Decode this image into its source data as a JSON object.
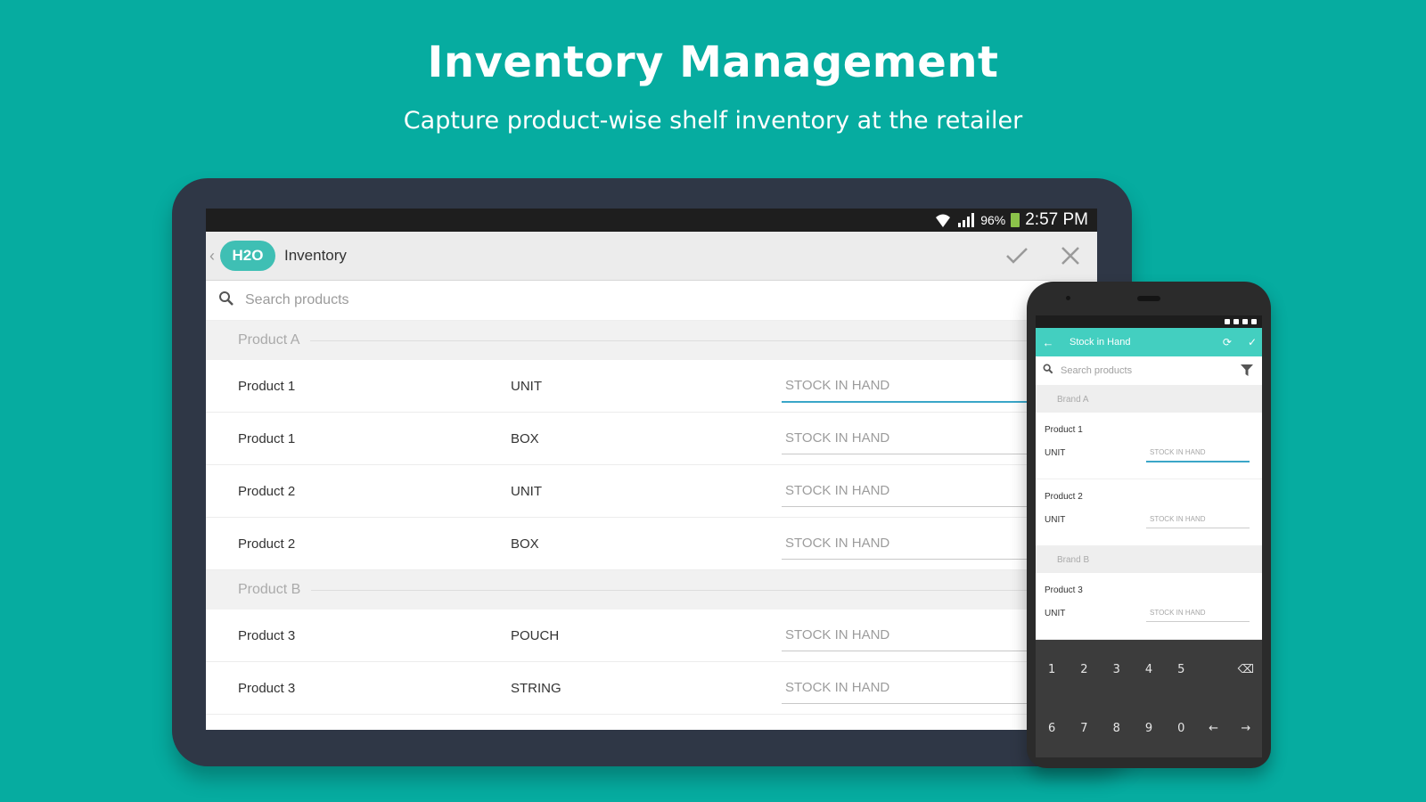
{
  "hero": {
    "title": "Inventory Management",
    "subtitle": "Capture product-wise shelf inventory at the retailer"
  },
  "tablet": {
    "status": {
      "battery": "96%",
      "time": "2:57 PM"
    },
    "appbar": {
      "logo_text": "H2O",
      "title": "Inventory",
      "confirm_icon": "check-icon",
      "close_icon": "close-icon"
    },
    "search": {
      "placeholder": "Search products"
    },
    "field_placeholder": "STOCK IN HAND",
    "groups": [
      {
        "name": "Product A",
        "rows": [
          {
            "product": "Product 1",
            "unit": "UNIT"
          },
          {
            "product": "Product 1",
            "unit": "BOX"
          },
          {
            "product": "Product 2",
            "unit": "UNIT"
          },
          {
            "product": "Product 2",
            "unit": "BOX"
          }
        ]
      },
      {
        "name": "Product B",
        "rows": [
          {
            "product": "Product 3",
            "unit": "POUCH"
          },
          {
            "product": "Product 3",
            "unit": "STRING"
          }
        ]
      }
    ]
  },
  "phone": {
    "appbar": {
      "title": "Stock in Hand"
    },
    "search": {
      "placeholder": "Search products"
    },
    "field_placeholder": "STOCK IN HAND",
    "groups": [
      {
        "name": "Brand A",
        "items": [
          {
            "product": "Product 1",
            "unit": "UNIT"
          },
          {
            "product": "Product 2",
            "unit": "UNIT"
          }
        ]
      },
      {
        "name": "Brand B",
        "items": [
          {
            "product": "Product 3",
            "unit": "UNIT"
          }
        ]
      }
    ],
    "keypad": [
      "1",
      "2",
      "3",
      "4",
      "5",
      "",
      "⌫",
      "6",
      "7",
      "8",
      "9",
      "0",
      "←",
      "→"
    ]
  },
  "colors": {
    "background": "#06aca0",
    "accent": "#43cfc0",
    "focus": "#3aa6c8"
  }
}
